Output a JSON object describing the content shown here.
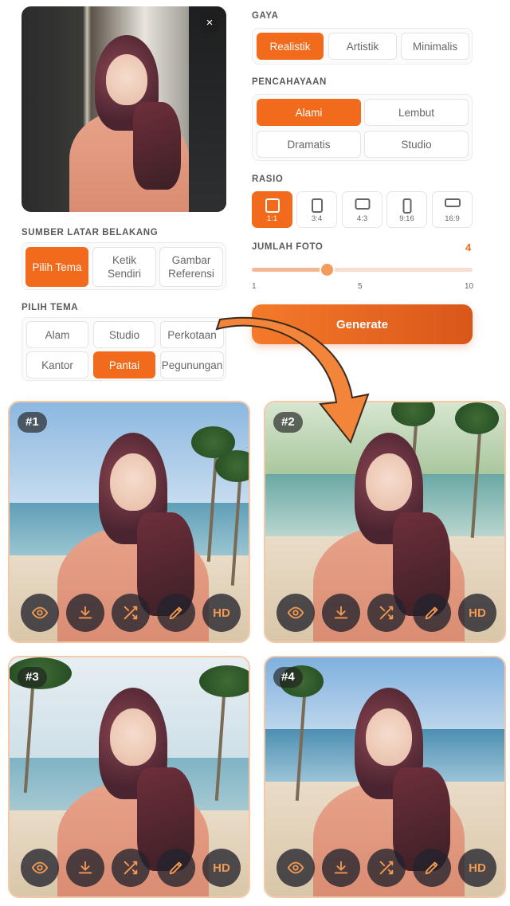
{
  "settings": {
    "gaya": {
      "label": "GAYA",
      "options": [
        "Realistik",
        "Artistik",
        "Minimalis"
      ],
      "selected": "Realistik"
    },
    "pencahayaan": {
      "label": "PENCAHAYAAN",
      "options": [
        "Alami",
        "Lembut",
        "Dramatis",
        "Studio"
      ],
      "selected": "Alami"
    },
    "rasio": {
      "label": "RASIO",
      "options": [
        "1:1",
        "3:4",
        "4:3",
        "9:16",
        "16:9"
      ],
      "selected": "1:1"
    },
    "jumlah_foto": {
      "label": "JUMLAH FOTO",
      "value": "4",
      "min": "1",
      "mid": "5",
      "max": "10",
      "fraction": 0.33
    },
    "generate_label": "Generate"
  },
  "sumber": {
    "label": "SUMBER LATAR BELAKANG",
    "options": [
      "Pilih Tema",
      "Ketik Sendiri",
      "Gambar Referensi"
    ],
    "selected": "Pilih Tema"
  },
  "tema": {
    "label": "PILIH TEMA",
    "options": [
      "Alam",
      "Studio",
      "Perkotaan",
      "Kantor",
      "Pantai",
      "Pegunungan"
    ],
    "selected": "Pantai"
  },
  "source_photo": {
    "close_icon": "close-icon",
    "close_glyph": "×"
  },
  "results": [
    {
      "badge": "#1"
    },
    {
      "badge": "#2"
    },
    {
      "badge": "#3"
    },
    {
      "badge": "#4"
    }
  ],
  "actions": {
    "hd_label": "HD",
    "icons": [
      "eye-icon",
      "download-icon",
      "shuffle-icon",
      "pencil-icon",
      "hd-icon"
    ]
  },
  "colors": {
    "accent": "#f26a1b",
    "accent_light": "#f7ddd0",
    "action_icon": "#f39a52"
  }
}
